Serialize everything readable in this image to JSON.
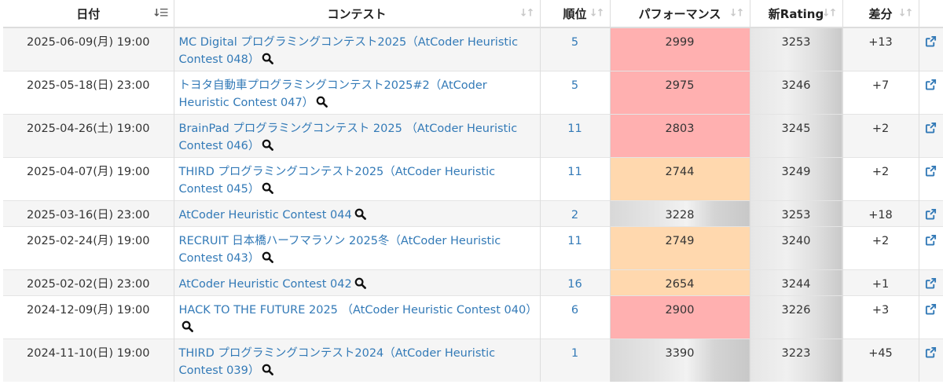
{
  "headers": {
    "date": "日付",
    "contest": "コンテスト",
    "rank": "順位",
    "performance": "パフォーマンス",
    "new_rating": "新Rating",
    "diff": "差分"
  },
  "sort_icons": {
    "active": "descending-sort-icon",
    "inactive": "sort-icon"
  },
  "rows": [
    {
      "date": "2025-06-09(月) 19:00",
      "contest": "MC Digital プログラミングコンテスト2025（AtCoder Heuristic Contest 048）",
      "rank": "5",
      "performance": "2999",
      "perf_color": "red",
      "new_rating": "3253",
      "diff": "+13"
    },
    {
      "date": "2025-05-18(日) 23:00",
      "contest": "トヨタ自動車プログラミングコンテスト2025#2（AtCoder Heuristic Contest 047）",
      "rank": "5",
      "performance": "2975",
      "perf_color": "red",
      "new_rating": "3246",
      "diff": "+7"
    },
    {
      "date": "2025-04-26(土) 19:00",
      "contest": "BrainPad プログラミングコンテスト 2025 （AtCoder Heuristic Contest 046）",
      "rank": "11",
      "performance": "2803",
      "perf_color": "red",
      "new_rating": "3245",
      "diff": "+2"
    },
    {
      "date": "2025-04-07(月) 19:00",
      "contest": "THIRD プログラミングコンテスト2025（AtCoder Heuristic Contest 045）",
      "rank": "11",
      "performance": "2744",
      "perf_color": "orange",
      "new_rating": "3249",
      "diff": "+2"
    },
    {
      "date": "2025-03-16(日) 23:00",
      "contest": "AtCoder Heuristic Contest 044",
      "rank": "2",
      "performance": "3228",
      "perf_color": "silver",
      "new_rating": "3253",
      "diff": "+18"
    },
    {
      "date": "2025-02-24(月) 19:00",
      "contest": "RECRUIT 日本橋ハーフマラソン 2025冬（AtCoder Heuristic Contest 043）",
      "rank": "11",
      "performance": "2749",
      "perf_color": "orange",
      "new_rating": "3240",
      "diff": "+2"
    },
    {
      "date": "2025-02-02(日) 23:00",
      "contest": "AtCoder Heuristic Contest 042",
      "rank": "16",
      "performance": "2654",
      "perf_color": "orange",
      "new_rating": "3244",
      "diff": "+1"
    },
    {
      "date": "2024-12-09(月) 19:00",
      "contest": "HACK TO THE FUTURE 2025 （AtCoder Heuristic Contest 040）",
      "rank": "6",
      "performance": "2900",
      "perf_color": "red",
      "new_rating": "3226",
      "diff": "+3"
    },
    {
      "date": "2024-11-10(日) 19:00",
      "contest": "THIRD プログラミングコンテスト2024（AtCoder Heuristic Contest 039）",
      "rank": "1",
      "performance": "3390",
      "perf_color": "silver",
      "new_rating": "3223",
      "diff": "+45"
    }
  ],
  "colors": {
    "link": "#337ab7",
    "perf_red": "#ffb0b0",
    "perf_orange": "#ffd8ae",
    "rating_silver": "#c9c9c9"
  },
  "icons": {
    "search": "search-icon",
    "external": "external-link-icon"
  }
}
